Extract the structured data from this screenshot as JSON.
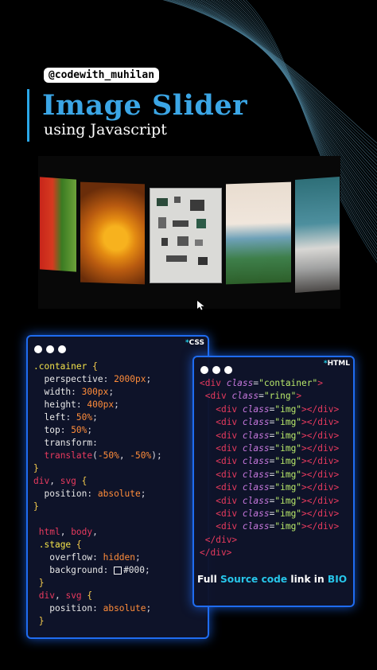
{
  "header": {
    "handle": "@codewith_muhilan",
    "title": "Image Slider",
    "subtitle": "using Javascript"
  },
  "slider": {
    "slides": [
      "red-grass-photo",
      "orange-cactus-photo",
      "desk-flatlay-photo",
      "coast-sunset-photo",
      "sky-clouds-photo"
    ]
  },
  "css_panel": {
    "tag_star": "*",
    "tag": "CSS"
  },
  "html_panel": {
    "tag_star": "*",
    "tag": "HTML"
  },
  "footer": {
    "prefix": "Full ",
    "highlight1": "Source code",
    "middle": " link in ",
    "highlight2": "BIO"
  },
  "colors": {
    "accent": "#3ba6e6",
    "panel_border": "#1f6cf0",
    "highlight": "#27c6ea"
  }
}
